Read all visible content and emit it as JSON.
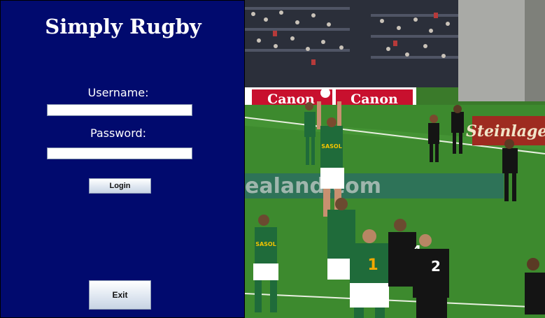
{
  "app": {
    "title": "Simply Rugby"
  },
  "login_form": {
    "username_label": "Username:",
    "username_value": "",
    "password_label": "Password:",
    "password_value": "",
    "login_button": "Login",
    "exit_button": "Exit"
  },
  "photo": {
    "subject": "rugby-lineout-photo",
    "ad_boards": [
      "Canon",
      "Canon",
      "Steinlager"
    ],
    "pitch_text": "ealand.com",
    "jersey_numbers": [
      "1",
      "4",
      "2"
    ],
    "jersey_sponsor": "SASOL"
  },
  "colors": {
    "panel_background": "#010a6e",
    "text": "#ffffff",
    "pitch": "#3d8a2e",
    "green_jersey": "#1f6b3a",
    "black_jersey": "#141414"
  }
}
